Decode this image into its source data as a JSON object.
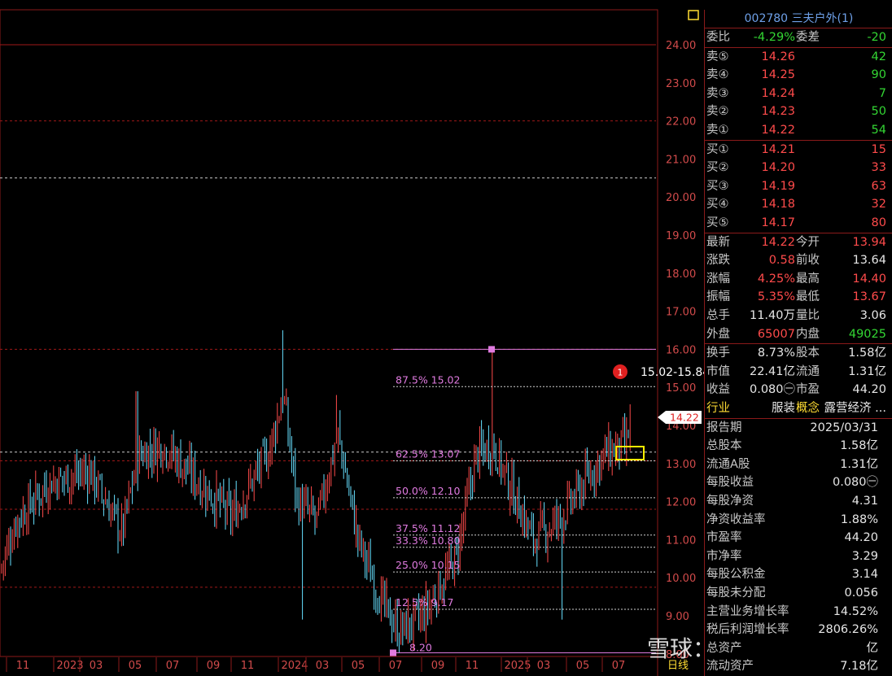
{
  "stock": {
    "code": "002780",
    "name": "三夫户外(1)"
  },
  "weibi": {
    "label1": "委比",
    "val1": "-4.29%",
    "label2": "委差",
    "val2": "-20"
  },
  "sell": [
    {
      "label": "卖⑤",
      "price": "14.26",
      "vol": "42"
    },
    {
      "label": "卖④",
      "price": "14.25",
      "vol": "90"
    },
    {
      "label": "卖③",
      "price": "14.24",
      "vol": "7"
    },
    {
      "label": "卖②",
      "price": "14.23",
      "vol": "50"
    },
    {
      "label": "卖①",
      "price": "14.22",
      "vol": "54"
    }
  ],
  "buy": [
    {
      "label": "买①",
      "price": "14.21",
      "vol": "15"
    },
    {
      "label": "买②",
      "price": "14.20",
      "vol": "33"
    },
    {
      "label": "买③",
      "price": "14.19",
      "vol": "63"
    },
    {
      "label": "买④",
      "price": "14.18",
      "vol": "32"
    },
    {
      "label": "买⑤",
      "price": "14.17",
      "vol": "80"
    }
  ],
  "quote": [
    {
      "l1": "最新",
      "v1": "14.22",
      "l2": "今开",
      "v2": "13.94"
    },
    {
      "l1": "涨跌",
      "v1": "0.58",
      "l2": "前收",
      "v2": "13.64"
    },
    {
      "l1": "涨幅",
      "v1": "4.25%",
      "l2": "最高",
      "v2": "14.40"
    },
    {
      "l1": "振幅",
      "v1": "5.35%",
      "l2": "最低",
      "v2": "13.67"
    },
    {
      "l1": "总手",
      "v1": "11.40万",
      "l2": "量比",
      "v2": "3.06"
    },
    {
      "l1": "外盘",
      "v1": "65007",
      "l2": "内盘",
      "v2": "49025"
    }
  ],
  "stats": [
    {
      "l1": "换手",
      "v1": "8.73%",
      "l2": "股本",
      "v2": "1.58亿"
    },
    {
      "l1": "市值",
      "v1": "22.41亿",
      "l2": "流通",
      "v2": "1.31亿"
    },
    {
      "l1": "收益",
      "v1": "0.080㊀",
      "l2": "市盈",
      "v2": "44.20"
    },
    {
      "l1": "行业",
      "v1": "服装",
      "l2": "概念",
      "v2": "露营经济 ..."
    }
  ],
  "finance": [
    {
      "label": "报告期",
      "value": "2025/03/31"
    },
    {
      "label": "总股本",
      "value": "1.58亿"
    },
    {
      "label": "流通A股",
      "value": "1.31亿"
    },
    {
      "label": "每股收益",
      "value": "0.080㊀"
    },
    {
      "label": "每股净资",
      "value": "4.31"
    },
    {
      "label": "净资收益率",
      "value": "1.88%"
    },
    {
      "label": "市盈率",
      "value": "44.20"
    },
    {
      "label": "市净率",
      "value": "3.29"
    },
    {
      "label": "每股公积金",
      "value": "3.14"
    },
    {
      "label": "每股未分配",
      "value": "0.056"
    },
    {
      "label": "主营业务增长率",
      "value": "14.52%"
    },
    {
      "label": "税后利润增长率",
      "value": "2806.26%"
    },
    {
      "label": "总资产",
      "value": "亿"
    },
    {
      "label": "流动资产",
      "value": "7.18亿"
    }
  ],
  "chart": {
    "price_ticks": [
      "24.00",
      "23.00",
      "22.00",
      "21.00",
      "20.00",
      "19.00",
      "18.00",
      "17.00",
      "16.00",
      "15.00",
      "14.00",
      "13.00",
      "12.00",
      "11.00",
      "10.00",
      "9.00",
      "8.00"
    ],
    "date_labels": [
      "11",
      "2023",
      "03",
      "05",
      "07",
      "09",
      "11",
      "2024",
      "03",
      "05",
      "07",
      "09",
      "11",
      "2025",
      "03",
      "05",
      "07"
    ],
    "period_label": "日线",
    "current_price_tag": "14.22",
    "range_badge": "1",
    "range_text": "15.02-15.84",
    "fib_levels": [
      {
        "label": "87.5% 15.02",
        "price": 15.02
      },
      {
        "label": "62.5% 13.07",
        "price": 13.07
      },
      {
        "label": "50.0% 12.10",
        "price": 12.1
      },
      {
        "label": "37.5% 11.12",
        "price": 11.12
      },
      {
        "label": "33.3% 10.80",
        "price": 10.8
      },
      {
        "label": "25.0% 10.15",
        "price": 10.15
      },
      {
        "label": "12.5% 9.17",
        "price": 9.17
      }
    ],
    "fib_low_label": "8.20",
    "watermark": "雪球：逯逯有为",
    "colors": {
      "up": "#ff4b4b",
      "down": "#66e0ff",
      "grid": "#a01818",
      "fib": "#e07be0"
    }
  }
}
